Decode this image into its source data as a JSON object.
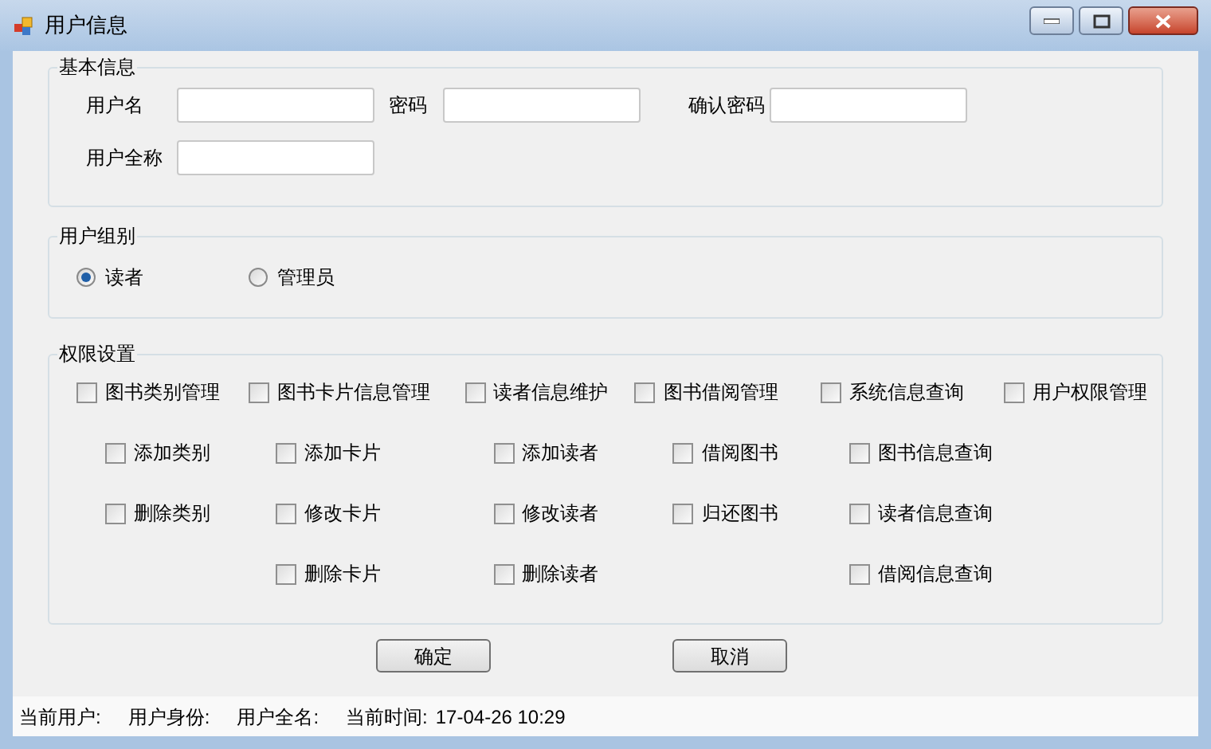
{
  "window": {
    "title": "用户信息"
  },
  "basic_info": {
    "title": "基本信息",
    "field_rows": [
      [
        {
          "label": "用户名"
        },
        {
          "label": "密码"
        },
        {
          "label": "确认密码"
        }
      ],
      [
        {
          "label": "用户全称"
        }
      ]
    ]
  },
  "user_group": {
    "title": "用户组别",
    "options": [
      {
        "label": "读者",
        "selected": true
      },
      {
        "label": "管理员",
        "selected": false
      }
    ]
  },
  "permissions": {
    "title": "权限设置",
    "groups": [
      {
        "label": "图书类别管理",
        "checked": false,
        "children": [
          {
            "label": "添加类别",
            "checked": false
          },
          {
            "label": "删除类别",
            "checked": false
          }
        ]
      },
      {
        "label": "图书卡片信息管理",
        "checked": false,
        "children": [
          {
            "label": "添加卡片",
            "checked": false
          },
          {
            "label": "修改卡片",
            "checked": false
          },
          {
            "label": "删除卡片",
            "checked": false
          }
        ]
      },
      {
        "label": "读者信息维护",
        "checked": false,
        "children": [
          {
            "label": "添加读者",
            "checked": false
          },
          {
            "label": "修改读者",
            "checked": false
          },
          {
            "label": "删除读者",
            "checked": false
          }
        ]
      },
      {
        "label": "图书借阅管理",
        "checked": false,
        "children": [
          {
            "label": "借阅图书",
            "checked": false
          },
          {
            "label": "归还图书",
            "checked": false
          }
        ]
      },
      {
        "label": "系统信息查询",
        "checked": false,
        "children": [
          {
            "label": "图书信息查询",
            "checked": false
          },
          {
            "label": "读者信息查询",
            "checked": false
          },
          {
            "label": "借阅信息查询",
            "checked": false
          }
        ]
      },
      {
        "label": "用户权限管理",
        "checked": false
      }
    ]
  },
  "buttons": [
    "确定",
    "取消"
  ],
  "status_bar": {
    "items": [
      "当前用户:",
      "用户身份:",
      "用户全名:",
      "当前时间:"
    ],
    "time": "17-04-26 10:29"
  }
}
